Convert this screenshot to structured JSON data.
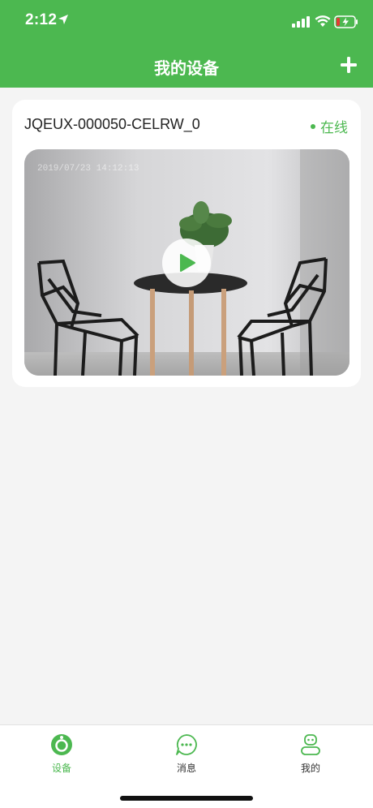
{
  "status_bar": {
    "time": "2:12"
  },
  "header": {
    "title": "我的设备",
    "add_icon": "plus-icon"
  },
  "device": {
    "name": "JQEUX-000050-CELRW_0",
    "status": "在线",
    "timestamp": "2019/07/23 14:12:13"
  },
  "colors": {
    "accent": "#4cb850"
  },
  "tabs": [
    {
      "label": "设备",
      "icon": "device-icon",
      "active": true
    },
    {
      "label": "消息",
      "icon": "message-icon",
      "active": false
    },
    {
      "label": "我的",
      "icon": "profile-icon",
      "active": false
    }
  ]
}
